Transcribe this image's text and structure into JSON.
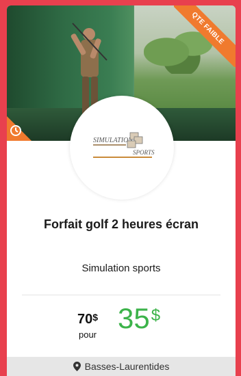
{
  "badge": {
    "label": "QTE FAIBLE",
    "color": "#f07a2e"
  },
  "logo": {
    "line1": "SIMULATION",
    "line2": "SPORTS"
  },
  "deal": {
    "title": "Forfait golf 2 heures écran",
    "merchant": "Simulation sports",
    "old_price": "70",
    "currency": "$",
    "pour": "pour",
    "new_price": "35"
  },
  "location": {
    "label": "Basses-Laurentides"
  },
  "icons": {
    "clock": "clock-icon",
    "pin": "map-pin-icon"
  },
  "colors": {
    "background": "#e8404e",
    "accent_green": "#3cb34a",
    "badge": "#f07a2e"
  }
}
